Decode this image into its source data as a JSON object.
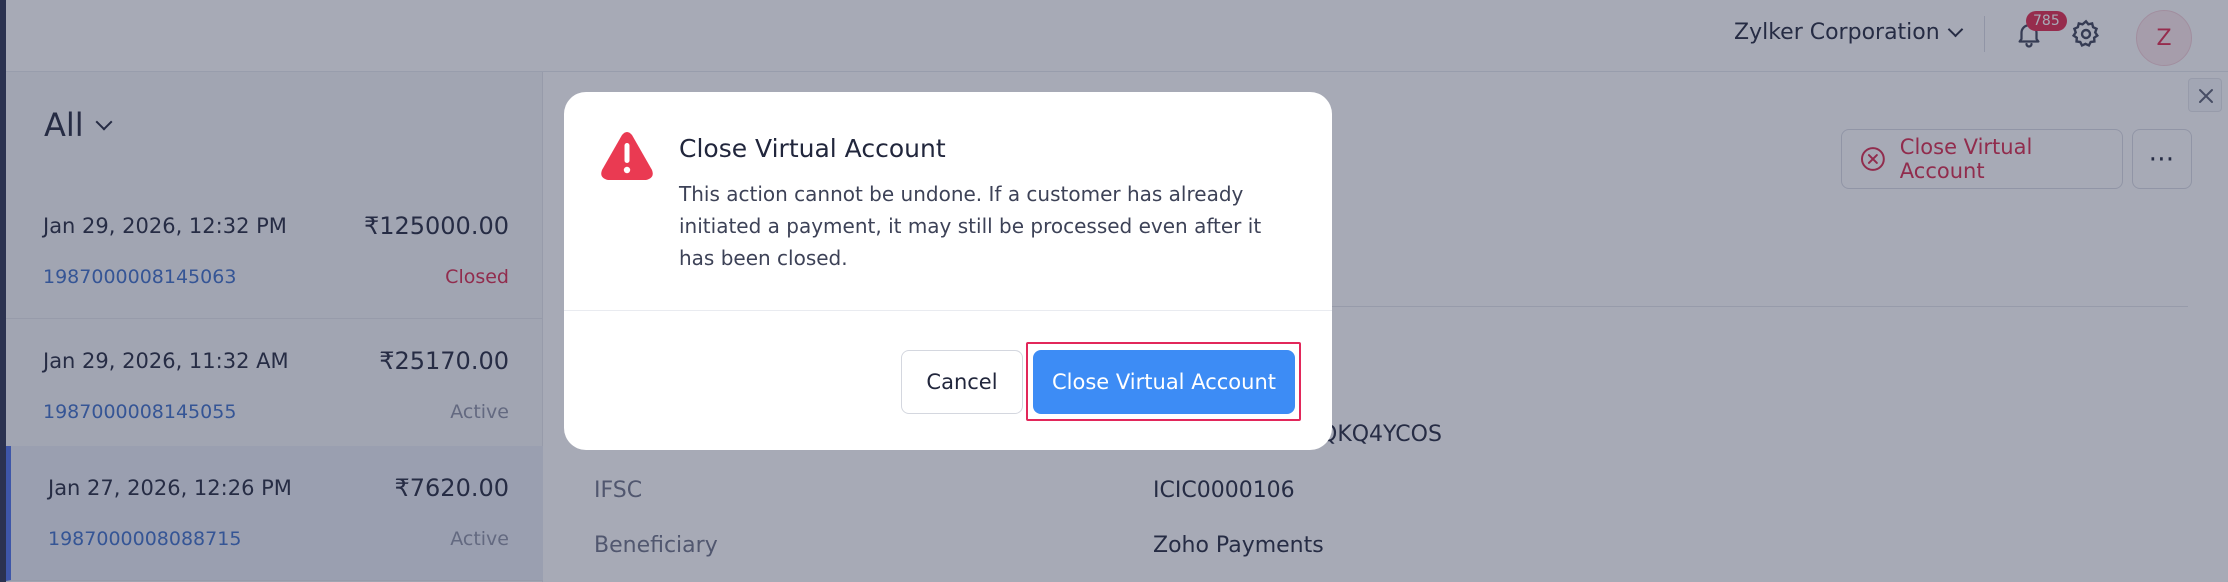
{
  "header": {
    "org_name": "Zylker Corporation",
    "notification_count": "785",
    "avatar_initial": "Z"
  },
  "sidebar": {
    "filter_label": "All",
    "items": [
      {
        "date": "Jan 29, 2026, 12:32 PM",
        "amount": "₹125000.00",
        "id": "1987000008145063",
        "status": "Closed"
      },
      {
        "date": "Jan 29, 2026, 11:32 AM",
        "amount": "₹25170.00",
        "id": "1987000008145055",
        "status": "Active"
      },
      {
        "date": "Jan 27, 2026, 12:26 PM",
        "amount": "₹7620.00",
        "id": "1987000008088715",
        "status": "Active"
      }
    ]
  },
  "detail": {
    "close_button_label": "Close Virtual Account",
    "account_partial": "QKQ4YCOS",
    "fields": [
      {
        "label": "IFSC",
        "value": "ICIC0000106"
      },
      {
        "label": "Beneficiary",
        "value": "Zoho Payments"
      }
    ]
  },
  "modal": {
    "title": "Close Virtual Account",
    "message": "This action cannot be undone. If a customer has already initiated a payment, it may still be processed even after it has been closed.",
    "cancel_label": "Cancel",
    "confirm_label": "Close Virtual Account"
  },
  "colors": {
    "primary": "#3d8cf5",
    "danger": "#e2274b",
    "link": "#3b6dc7",
    "overlay": "rgba(46,52,80,0.42)"
  }
}
